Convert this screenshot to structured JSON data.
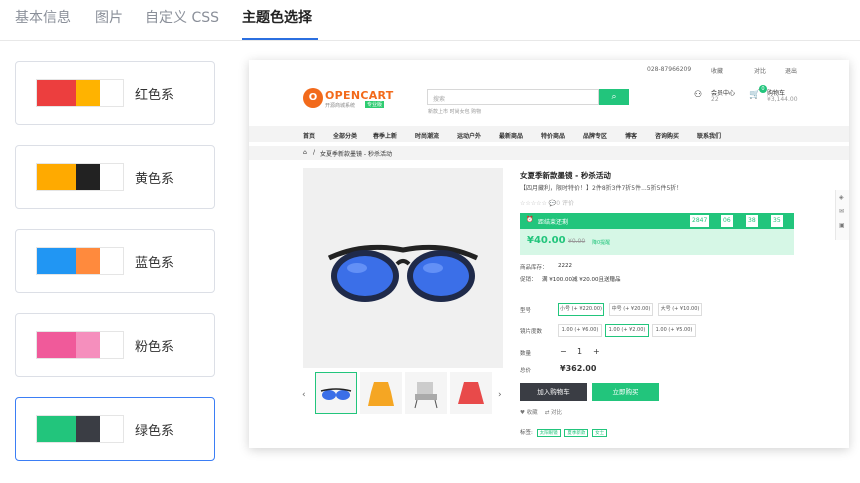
{
  "tabs": [
    {
      "label": "基本信息"
    },
    {
      "label": "图片"
    },
    {
      "label": "自定义 CSS"
    },
    {
      "label": "主题色选择"
    }
  ],
  "active_tab_index": 3,
  "themes": [
    {
      "label": "红色系",
      "colors": [
        "#ec3e3e",
        "#ffb300",
        "#ffffff"
      ]
    },
    {
      "label": "黄色系",
      "colors": [
        "#ffaa00",
        "#222222",
        "#ffffff"
      ]
    },
    {
      "label": "蓝色系",
      "colors": [
        "#2196f3",
        "#ff8a3d",
        "#ffffff"
      ]
    },
    {
      "label": "粉色系",
      "colors": [
        "#f05a9a",
        "#f58fbd",
        "#ffffff"
      ]
    },
    {
      "label": "绿色系",
      "colors": [
        "#22c57c",
        "#3a3d44",
        "#ffffff"
      ]
    }
  ],
  "selected_theme_index": 4,
  "preview": {
    "topbar": {
      "phone": "028-87966209",
      "favorites": "收藏",
      "compare": "对比",
      "logout": "退出"
    },
    "logo": {
      "mark": "O",
      "text": "OPENCART",
      "sub": "开源商城系统",
      "badge": "专业版"
    },
    "search": {
      "placeholder": "搜索",
      "hints": "新款上市   时尚女包   购物"
    },
    "account": {
      "label": "会员中心",
      "value": "22"
    },
    "cart": {
      "label": "购物车",
      "value": "¥3,144.00",
      "count": "0"
    },
    "nav": [
      "首页",
      "全部分类",
      "春季上新",
      "时尚潮流",
      "运动户外",
      "最新商品",
      "特价商品",
      "品牌专区",
      "博客",
      "咨询购买",
      "联系我们"
    ],
    "breadcrumb": "女夏季新款墨镜 - 秒杀活动",
    "product": {
      "title": "女夏季新款墨镜 - 秒杀活动",
      "promo": "【四月藏利，限时特价！】2件8折3件7折5件...5折5件5折！",
      "rating": "☆☆☆☆☆  💬0 评价",
      "flash_label": "距结束还剩",
      "countdown": {
        "days": "2847",
        "hours": "06",
        "minutes": "38",
        "seconds": "35"
      },
      "price": "¥40.00",
      "old_price": "¥0.00",
      "saved": "降0提醒",
      "stock_label": "商品库存：",
      "stock_value": "2222",
      "promo_label": "促销：",
      "promo_value": "满 ¥100.00减 ¥20.00且送赠品",
      "model_label": "型号",
      "models": [
        "小号 (+ ¥220.00)",
        "中号 (+ ¥20.00)",
        "大号 (+ ¥10.00)"
      ],
      "lens_label": "镜片度数",
      "lenses": [
        "1.00 (+ ¥6.00)",
        "1.00 (+ ¥2.00)",
        "1.00 (+ ¥5.00)"
      ],
      "qty_label": "数量",
      "qty": "1",
      "total_label": "总价",
      "total": "¥362.00",
      "add_cart": "加入购物车",
      "buy_now": "立即购买",
      "wishlist": "♥ 收藏",
      "compare": "⇄ 对比",
      "tags_label": "标签:",
      "tags": [
        "太阳眼镜",
        "夏季新款",
        "女士"
      ]
    }
  }
}
